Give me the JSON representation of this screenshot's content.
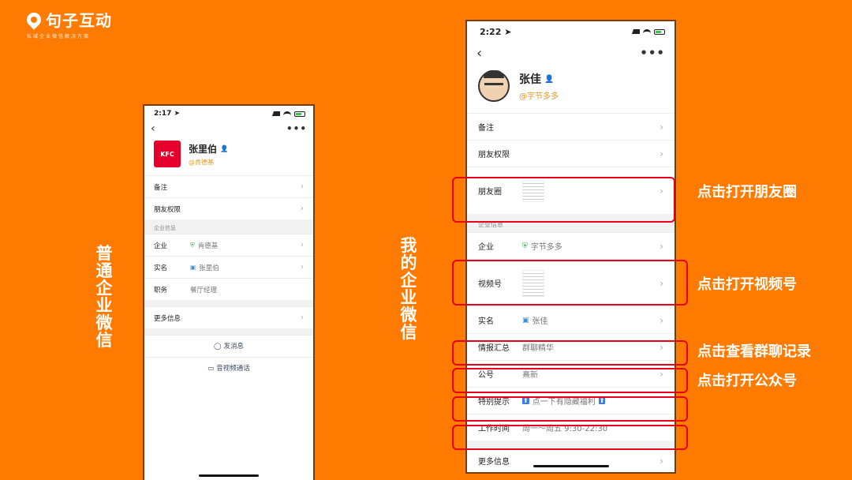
{
  "brand": {
    "name": "句子互动",
    "tagline": "私域企业微信解决方案"
  },
  "left_caption": "普通企业微信",
  "right_caption": "我的企业微信",
  "small_phone": {
    "time": "2:17 ➤",
    "back": "‹",
    "more": "•••",
    "avatar_text": "KFC",
    "name": "张里伯",
    "corp": "@肯德基",
    "rows_top": [
      {
        "label": "备注",
        "chev": "›"
      },
      {
        "label": "朋友权限",
        "chev": "›"
      }
    ],
    "section": "企业信息",
    "rows_corp": [
      {
        "label": "企业",
        "value": "肯德基",
        "chev": "›"
      },
      {
        "label": "实名",
        "value": "张里伯",
        "chev": "›"
      },
      {
        "label": "职务",
        "value": "餐厅经理",
        "chev": ""
      }
    ],
    "more_info": "更多信息",
    "more_info_chev": "›",
    "send_message": "发消息",
    "av_call": "音视频通话"
  },
  "big_phone": {
    "time": "2:22 ➤",
    "back": "‹",
    "more": "•••",
    "name": "张佳",
    "corp": "@字节多多",
    "rows_top": [
      {
        "label": "备注",
        "chev": "›"
      },
      {
        "label": "朋友权限",
        "chev": "›"
      },
      {
        "label": "朋友圈",
        "chev": "›"
      }
    ],
    "section": "企业信息",
    "rows_corp": [
      {
        "label": "企业",
        "value": "字节多多",
        "chev": "›"
      },
      {
        "label": "视频号",
        "value": "",
        "chev": "›"
      },
      {
        "label": "实名",
        "value": "张佳",
        "chev": "›"
      },
      {
        "label": "情报汇总",
        "value": "群聊精华",
        "chev": "›"
      },
      {
        "label": "公号",
        "value": "熹新",
        "chev": "›"
      },
      {
        "label": "特别提示",
        "value": "点一下有隐藏福利",
        "chev": ""
      },
      {
        "label": "工作时间",
        "value": "周一～周五 9:30-22:30",
        "chev": ""
      }
    ],
    "more_info": "更多信息",
    "more_info_chev": "›"
  },
  "callouts": [
    "点击打开朋友圈",
    "点击打开视频号",
    "点击查看群聊记录",
    "点击打开公众号"
  ],
  "colors": {
    "background": "#ff7a00",
    "highlight": "#e8001a",
    "verified": "#27b04a"
  }
}
